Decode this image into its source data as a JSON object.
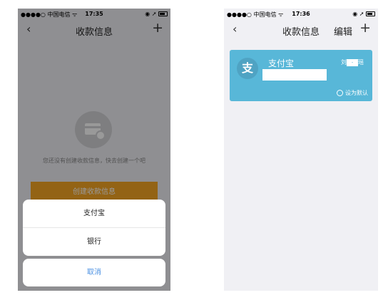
{
  "left_screen": {
    "statusbar": {
      "carrier": "●●●●○ 中国电信 ᯤ",
      "time": "17:35",
      "indicators": "◉ ➚"
    },
    "navbar": {
      "back": "‹",
      "title": "收款信息",
      "add": "+"
    },
    "empty_state": {
      "icon": "card-coin-icon",
      "text": "您还没有创建收款信息，快去创建一个吧",
      "button": "创建收款信息"
    },
    "action_sheet": {
      "options": [
        "支付宝",
        "银行"
      ],
      "cancel": "取消"
    }
  },
  "right_screen": {
    "statusbar": {
      "carrier": "●●●●○ 中国电信 ᯤ",
      "time": "17:36",
      "indicators": "◉ ➚"
    },
    "navbar": {
      "back": "‹",
      "title": "收款信息",
      "edit": "编辑",
      "add": "+"
    },
    "account_card": {
      "logo": "支",
      "name": "支付宝",
      "owner_prefix": "刘",
      "owner_mask": "-",
      "owner_suffix": "瑶",
      "default_label": "设为默认"
    }
  },
  "colors": {
    "primary_button": "#f5a623",
    "card_background": "#58b7d8",
    "cancel_text": "#4a90e2"
  }
}
